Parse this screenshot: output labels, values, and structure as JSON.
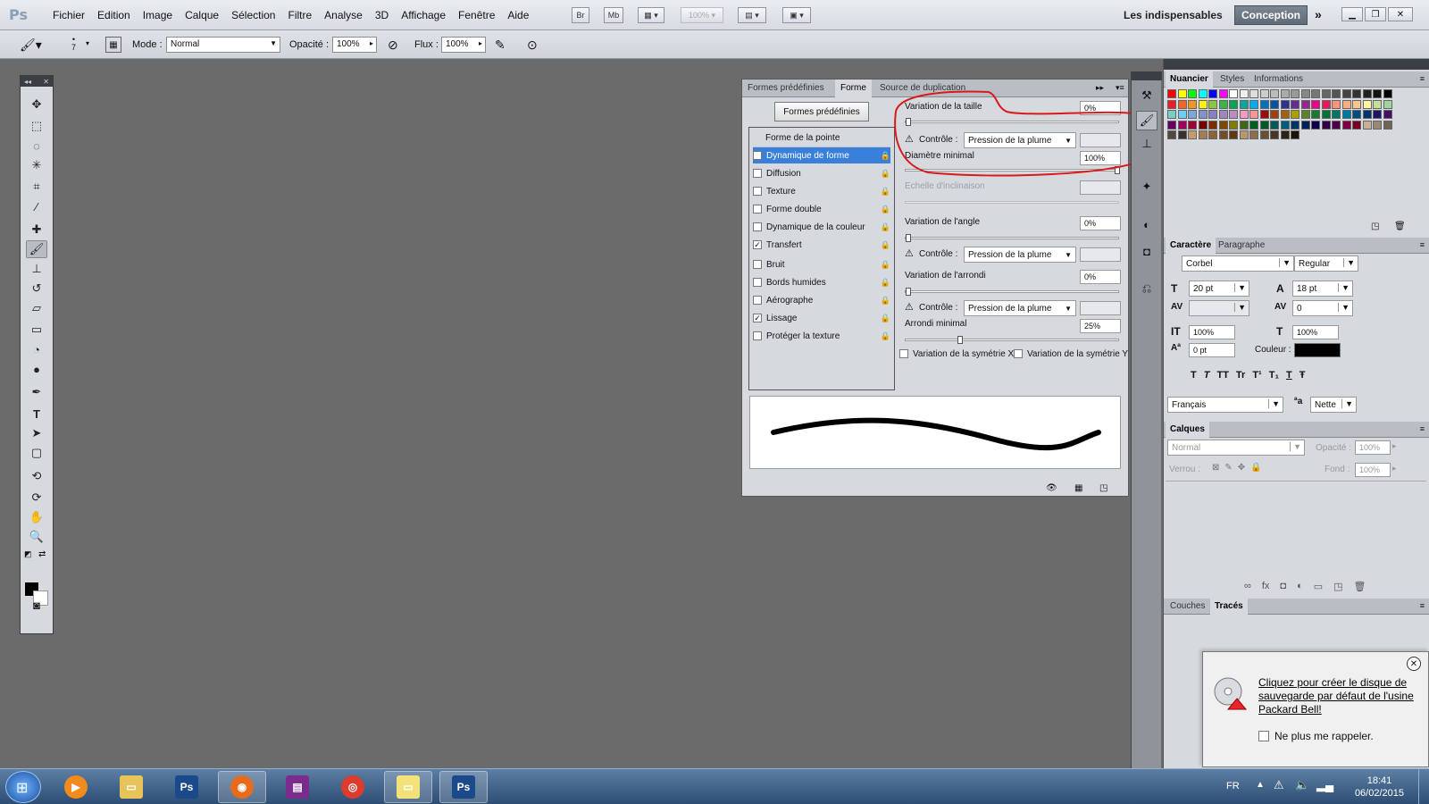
{
  "app": {
    "logo": "Ps",
    "menu": [
      "Fichier",
      "Edition",
      "Image",
      "Calque",
      "Sélection",
      "Filtre",
      "Analyse",
      "3D",
      "Affichage",
      "Fenêtre",
      "Aide"
    ],
    "bridge_label": "Br",
    "minibridge_label": "Mb",
    "zoom": "100%",
    "workspace_label": "Les indispensables",
    "workspace_active": "Conception"
  },
  "options": {
    "brush_size": "7",
    "mode_label": "Mode :",
    "mode_value": "Normal",
    "opacity_label": "Opacité :",
    "opacity_value": "100%",
    "flow_label": "Flux :",
    "flow_value": "100%"
  },
  "brush_panel": {
    "tabs": [
      "Formes prédéfinies",
      "Forme",
      "Source de duplication"
    ],
    "active_tab": "Forme",
    "preset_button": "Formes prédéfinies",
    "list_header": "Forme de la pointe",
    "items": [
      {
        "label": "Dynamique de forme",
        "checked": "✓"
      },
      {
        "label": "Diffusion",
        "checked": ""
      },
      {
        "label": "Texture",
        "checked": ""
      },
      {
        "label": "Forme double",
        "checked": ""
      },
      {
        "label": "Dynamique de la couleur",
        "checked": ""
      },
      {
        "label": "Transfert",
        "checked": "✓"
      },
      {
        "label": "Bruit",
        "checked": ""
      },
      {
        "label": "Bords humides",
        "checked": ""
      },
      {
        "label": "Aérographe",
        "checked": ""
      },
      {
        "label": "Lissage",
        "checked": "✓"
      },
      {
        "label": "Protéger la texture",
        "checked": ""
      }
    ],
    "size_jitter_label": "Variation de la taille",
    "size_jitter_value": "0%",
    "control_label": "Contrôle :",
    "control_value": "Pression de la plume",
    "min_diameter_label": "Diamètre minimal",
    "min_diameter_value": "100%",
    "tilt_scale_label": "Echelle d'inclinaison",
    "angle_jitter_label": "Variation de l'angle",
    "angle_jitter_value": "0%",
    "roundness_jitter_label": "Variation de l'arrondi",
    "roundness_jitter_value": "0%",
    "min_roundness_label": "Arrondi minimal",
    "min_roundness_value": "25%",
    "flip_x_label": "Variation de la symétrie X",
    "flip_y_label": "Variation de la symétrie Y"
  },
  "swatches": {
    "tabs": [
      "Nuancier",
      "Styles",
      "Informations"
    ],
    "top_row": [
      "#ff0000",
      "#ffff00",
      "#00ff00",
      "#00ffff",
      "#0000ff",
      "#ff00ff",
      "#ffffff",
      "#eeeeee",
      "#dddddd",
      "#cccccc",
      "#bbbbbb",
      "#aaaaaa",
      "#999999",
      "#888888",
      "#777777",
      "#666666",
      "#555555",
      "#444444",
      "#333333",
      "#222222",
      "#111111",
      "#000000"
    ],
    "rows": [
      [
        "#ee1c24",
        "#f26522",
        "#f7941d",
        "#fff200",
        "#8dc63f",
        "#39b54a",
        "#00a651",
        "#00a99d",
        "#00aeef",
        "#0072bc",
        "#0054a6",
        "#2e3192",
        "#662d91",
        "#92278f",
        "#ec008c",
        "#ed145b",
        "#f69679",
        "#f9ad81",
        "#fdc689",
        "#fff799",
        "#c4df9b",
        "#a3d39c"
      ],
      [
        "#7accc8",
        "#6dcff6",
        "#7da7d9",
        "#8393ca",
        "#8781bd",
        "#a186be",
        "#bd8cbf",
        "#f49ac1",
        "#f5989d",
        "#9e0b0f",
        "#a0410d",
        "#a36209",
        "#aba000",
        "#598527",
        "#1a7b30",
        "#007236",
        "#00746b",
        "#0076a3",
        "#004b80",
        "#003471",
        "#1b1464",
        "#440e62"
      ],
      [
        "#630460",
        "#9e005d",
        "#9e0039",
        "#790000",
        "#7b2e00",
        "#7d4900",
        "#827b00",
        "#406618",
        "#005e20",
        "#005826",
        "#005952",
        "#005b7f",
        "#003663",
        "#002157",
        "#0d004c",
        "#32004b",
        "#4b0049",
        "#7b0046",
        "#7a0026",
        "#c7b299",
        "#998675",
        "#736357"
      ],
      [
        "#534741",
        "#37302d",
        "#c69c6d",
        "#a67c52",
        "#8c6239",
        "#754c24",
        "#603913",
        "#b7986a",
        "#8f6f4b",
        "#6b4f32",
        "#4a3521",
        "#2f2114",
        "#1a120b"
      ]
    ]
  },
  "character": {
    "tabs": [
      "Caractère",
      "Paragraphe"
    ],
    "font": "Corbel",
    "style": "Regular",
    "size": "20 pt",
    "leading": "18 pt",
    "kerning": "",
    "tracking": "0",
    "vscale": "100%",
    "hscale": "100%",
    "baseline": "0 pt",
    "color_label": "Couleur :",
    "language": "Français",
    "antialias": "Nette",
    "aa_label": "a",
    "style_buttons": [
      "T",
      "T",
      "TT",
      "Tr",
      "T¹",
      "T₁",
      "T",
      "Ŧ"
    ]
  },
  "layers": {
    "tabs": [
      "Calques"
    ],
    "blend": "Normal",
    "opacity_label": "Opacité :",
    "opacity": "100%",
    "lock_label": "Verrou :",
    "fill_label": "Fond :",
    "fill": "100%"
  },
  "paths": {
    "tabs": [
      "Couches",
      "Tracés"
    ]
  },
  "notification": {
    "message": "Cliquez pour créer le disque de sauvegarde par défaut de l'usine Packard Bell!",
    "checkbox": "Ne plus me rappeler."
  },
  "taskbar": {
    "apps": [
      "Windows Media Player",
      "Explorateur",
      "Photoshop",
      "Firefox",
      "WinRAR",
      "Chrome",
      "Notes",
      "Photoshop"
    ],
    "lang": "FR",
    "time": "18:41",
    "date": "06/02/2015"
  },
  "colors": {
    "accent": "#3a7fd9",
    "annotation": "#d9191b",
    "foreground": "#000000"
  }
}
